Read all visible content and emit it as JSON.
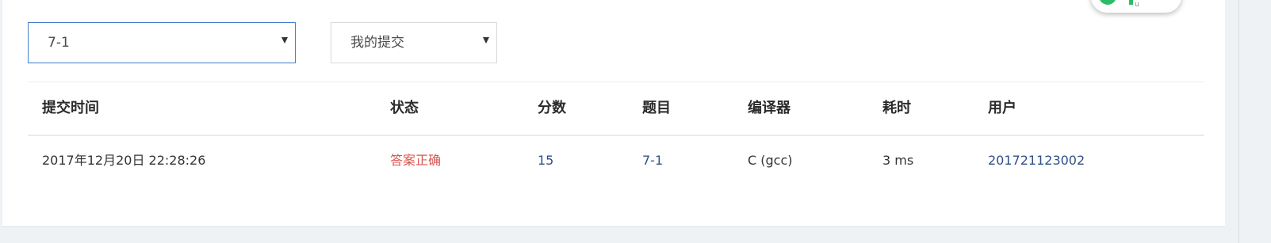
{
  "filters": {
    "problem_select": "7-1",
    "scope_select": "我的提交"
  },
  "table": {
    "headers": [
      "提交时间",
      "状态",
      "分数",
      "题目",
      "编译器",
      "耗时",
      "用户"
    ],
    "rows": [
      {
        "submit_time": "2017年12月20日 22:28:26",
        "status": "答案正确",
        "score": "15",
        "problem": "7-1",
        "compiler": "C (gcc)",
        "time_cost": "3 ms",
        "user": "201721123002"
      }
    ]
  },
  "colors": {
    "accent_border": "#3f7fc9",
    "status_ok": "#d9534f",
    "link": "#2d4f86",
    "widget_green": "#2dbb67"
  },
  "icons": {
    "dropdown": "caret-down-icon",
    "widget": "status-widget-icon"
  }
}
